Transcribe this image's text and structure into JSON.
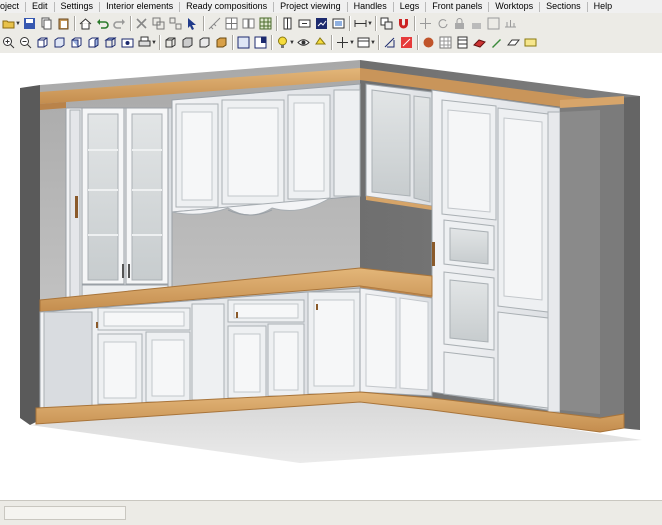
{
  "menu": {
    "items": [
      "oject",
      "Edit",
      "Settings",
      "Interior elements",
      "Ready compositions",
      "Project viewing",
      "Handles",
      "Legs",
      "Front panels",
      "Worktops",
      "Sections",
      "Help"
    ]
  },
  "toolbar_top": {
    "icons": [
      "open-icon",
      "save-icon",
      "copy-icon",
      "paste-icon",
      "home-icon",
      "undo-icon",
      "redo-icon",
      "delete-icon",
      "duplicate-icon",
      "group-icon",
      "select-arrow-icon",
      "measure-icon",
      "grid-icon",
      "align-icon",
      "column-icon",
      "mirror-icon",
      "split-icon",
      "frame-icon",
      "render-icon",
      "report-icon",
      "level-icon",
      "dimension-icon",
      "layers-icon",
      "magnet-icon",
      "move-icon",
      "rotate-icon",
      "lock-icon",
      "unlock-icon",
      "snap-icon",
      "grid-view-icon"
    ]
  },
  "toolbar_bottom": {
    "icons": [
      "zoom-in-icon",
      "zoom-out-icon",
      "view-front-icon",
      "view-back-icon",
      "view-left-icon",
      "view-right-icon",
      "view-top-icon",
      "camera-icon",
      "print-icon",
      "cube-wire-icon",
      "cube-solid-icon",
      "cube-texture-icon",
      "cube-shaded-icon",
      "perspective-icon",
      "window-icon",
      "light-icon",
      "eye-icon",
      "lamp-icon",
      "axis-icon",
      "layout-icon",
      "materials-icon",
      "catalog-icon",
      "texture-icon",
      "brush-icon",
      "door-icon",
      "wall-icon",
      "pen-icon",
      "eraser-icon",
      "settings-icon"
    ]
  },
  "colors": {
    "menubar": "#f0f0f0",
    "toolbar": "#ecebe6",
    "wall": "#9a9a9a",
    "cabinet": "#e7e9ec",
    "cabinet_shadow": "#cfd3d8",
    "wood": "#d6a468",
    "floor": "#e4e4e4"
  }
}
